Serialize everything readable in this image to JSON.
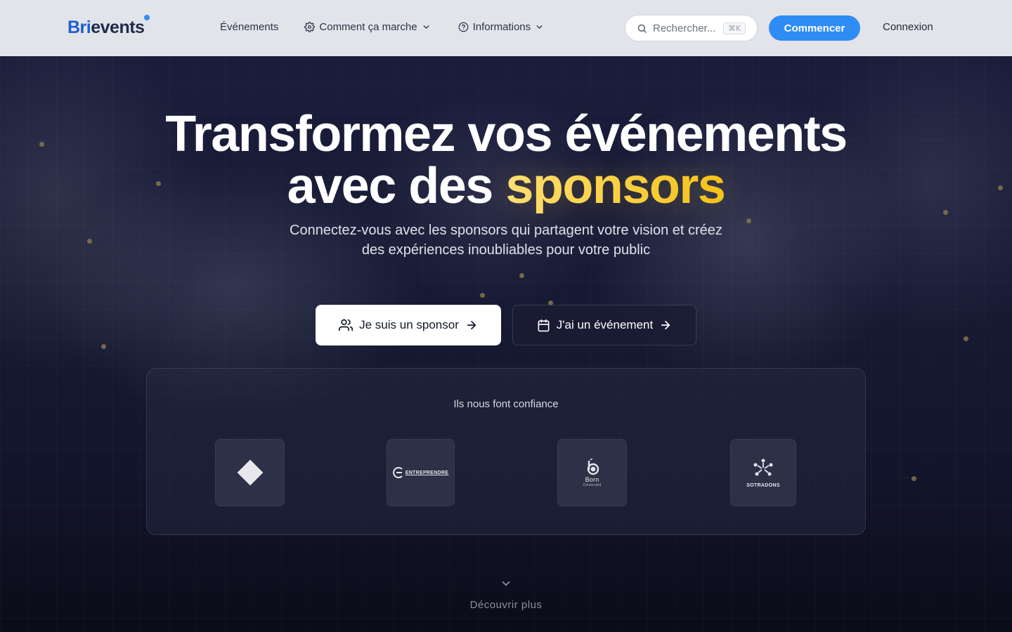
{
  "brand": {
    "prefix": "Bri",
    "suffix": "events"
  },
  "nav": {
    "items": [
      {
        "label": "Événements"
      },
      {
        "label": "Comment ça marche"
      },
      {
        "label": "Informations"
      }
    ],
    "search_placeholder": "Rechercher...",
    "search_shortcut": "⌘K",
    "cta_label": "Commencer",
    "login_label": "Connexion"
  },
  "hero": {
    "headline_line1": "Transformez vos événements",
    "headline_line2_prefix": "avec des ",
    "headline_accent": "sponsors",
    "subhead_line1": "Connectez-vous avec les sponsors qui partagent votre vision et créez",
    "subhead_line2": "des expériences inoubliables pour votre public",
    "primary_button": "Je suis un sponsor",
    "secondary_button": "J'ai un événement"
  },
  "trust": {
    "title": "Ils nous font confiance",
    "logos": [
      {
        "name": "diamond-logo",
        "text": ""
      },
      {
        "name": "entreprendre-logo",
        "text": "ENTREPRENDRE"
      },
      {
        "name": "born-logo",
        "text": "Born",
        "subtext": "Connected"
      },
      {
        "name": "sotradons-logo",
        "text": "SOTRADONS"
      }
    ]
  },
  "discover": {
    "label": "Découvrir plus"
  },
  "colors": {
    "accent_blue": "#2f8cf5",
    "logo_blue": "#1d5fd1",
    "highlight_yellow": "#f4c419",
    "navbar_bg": "#e2e4e9",
    "hero_bg": "#171a33"
  }
}
